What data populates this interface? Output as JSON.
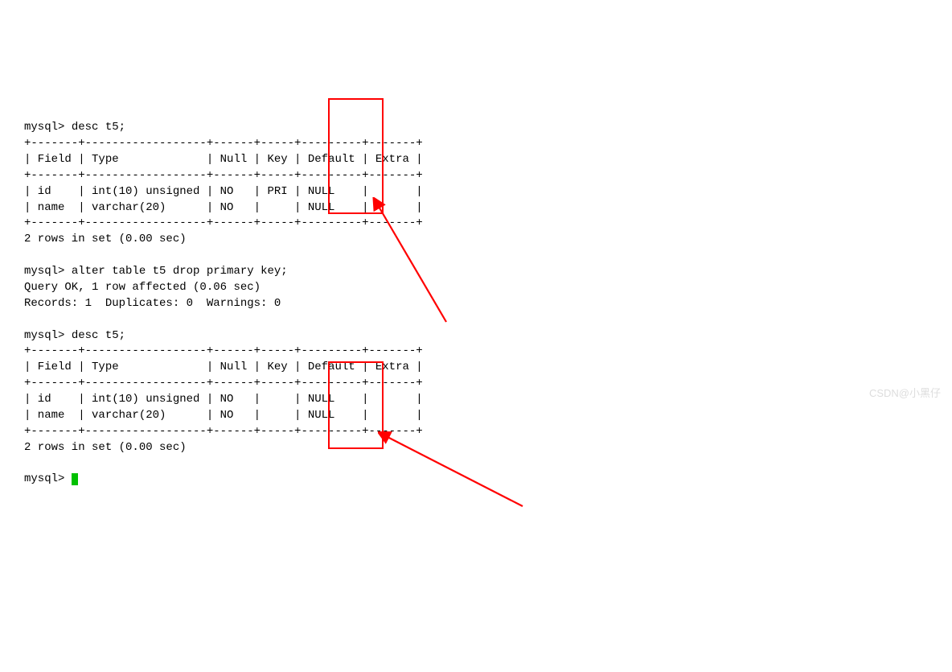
{
  "prompt": "mysql>",
  "cmd1": "desc t5;",
  "table1": {
    "border_top": "+-------+------------------+------+-----+---------+-------+",
    "header": "| Field | Type             | Null | Key | Default | Extra |",
    "border_mid": "+-------+------------------+------+-----+---------+-------+",
    "row1": "| id    | int(10) unsigned | NO   | PRI | NULL    |       |",
    "row2": "| name  | varchar(20)      | NO   |     | NULL    |       |",
    "border_bot": "+-------+------------------+------+-----+---------+-------+"
  },
  "summary1": "2 rows in set (0.00 sec)",
  "cmd2": "alter table t5 drop primary key;",
  "result2a": "Query OK, 1 row affected (0.06 sec)",
  "result2b": "Records: 1  Duplicates: 0  Warnings: 0",
  "cmd3": "desc t5;",
  "table2": {
    "border_top": "+-------+------------------+------+-----+---------+-------+",
    "header": "| Field | Type             | Null | Key | Default | Extra |",
    "border_mid": "+-------+------------------+------+-----+---------+-------+",
    "row1": "| id    | int(10) unsigned | NO   |     | NULL    |       |",
    "row2": "| name  | varchar(20)      | NO   |     | NULL    |       |",
    "border_bot": "+-------+------------------+------+-----+---------+-------+"
  },
  "summary2": "2 rows in set (0.00 sec)",
  "watermark": "CSDN@小黑仔"
}
